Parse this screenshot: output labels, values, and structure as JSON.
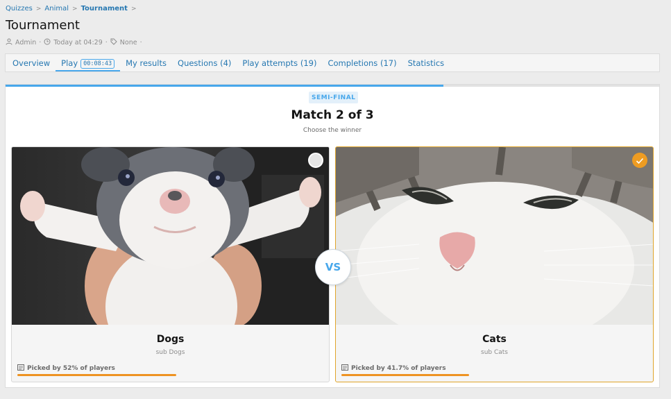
{
  "breadcrumb": {
    "items": [
      {
        "label": "Quizzes"
      },
      {
        "label": "Animal"
      },
      {
        "label": "Tournament"
      }
    ],
    "separator": ">"
  },
  "page": {
    "title": "Tournament",
    "meta": {
      "author": "Admin",
      "time": "Today at 04:29",
      "tags": "None"
    }
  },
  "tabs": [
    {
      "label": "Overview"
    },
    {
      "label": "Play",
      "timer": "00:08:43",
      "active": true
    },
    {
      "label": "My results"
    },
    {
      "label": "Questions (4)"
    },
    {
      "label": "Play attempts (19)"
    },
    {
      "label": "Completions (17)"
    },
    {
      "label": "Statistics"
    }
  ],
  "tournament": {
    "progress": 0.67,
    "round": "SEMI-FINAL",
    "match_title": "Match 2 of 3",
    "instruction": "Choose the winner",
    "vs_label": "VS",
    "contenders": [
      {
        "name": "Dogs",
        "subtitle": "sub Dogs",
        "picked_text": "Picked by 52% of players",
        "picked_fraction": 0.52,
        "selected": false
      },
      {
        "name": "Cats",
        "subtitle": "sub Cats",
        "picked_text": "Picked by 41.7% of players",
        "picked_fraction": 0.417,
        "selected": true
      }
    ]
  },
  "colors": {
    "link": "#2577b1",
    "accent": "#47a7eb",
    "selected": "#ee9c22",
    "bar": "#ee9322"
  },
  "icons": [
    "user-icon",
    "clock-icon",
    "tag-icon",
    "check-icon",
    "vote-icon"
  ]
}
